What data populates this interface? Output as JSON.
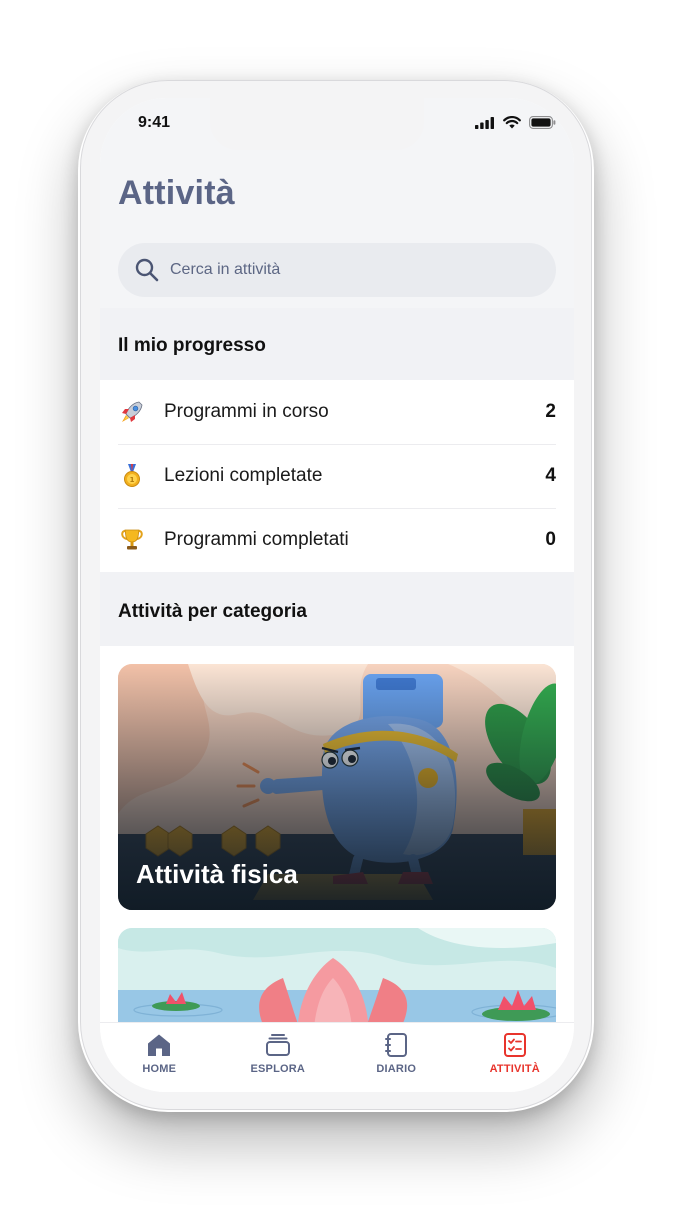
{
  "status_bar": {
    "time": "9:41",
    "icons": [
      "signal-icon",
      "wifi-icon",
      "battery-icon"
    ]
  },
  "page": {
    "title": "Attività"
  },
  "search": {
    "placeholder": "Cerca in attività",
    "icon": "search-icon"
  },
  "progress": {
    "header": "Il mio progresso",
    "items": [
      {
        "icon": "rocket-icon",
        "label": "Programmi in corso",
        "count": "2"
      },
      {
        "icon": "medal-icon",
        "label": "Lezioni completate",
        "count": "4"
      },
      {
        "icon": "trophy-icon",
        "label": "Programmi completati",
        "count": "0"
      }
    ]
  },
  "categories": {
    "header": "Attività per categoria",
    "cards": [
      {
        "title": "Attività fisica",
        "illustration": "fitness-character-illustration"
      },
      {
        "title": "",
        "illustration": "lotus-pond-illustration"
      }
    ]
  },
  "tabbar": {
    "tabs": [
      {
        "label": "HOME",
        "icon": "home-icon",
        "active": false
      },
      {
        "label": "ESPLORA",
        "icon": "stack-icon",
        "active": false
      },
      {
        "label": "DIARIO",
        "icon": "notebook-icon",
        "active": false
      },
      {
        "label": "ATTIVITÀ",
        "icon": "checklist-icon",
        "active": true
      }
    ]
  },
  "colors": {
    "accent": "#e8342c",
    "title": "#5b6586",
    "header_bg": "#f1f2f5"
  }
}
